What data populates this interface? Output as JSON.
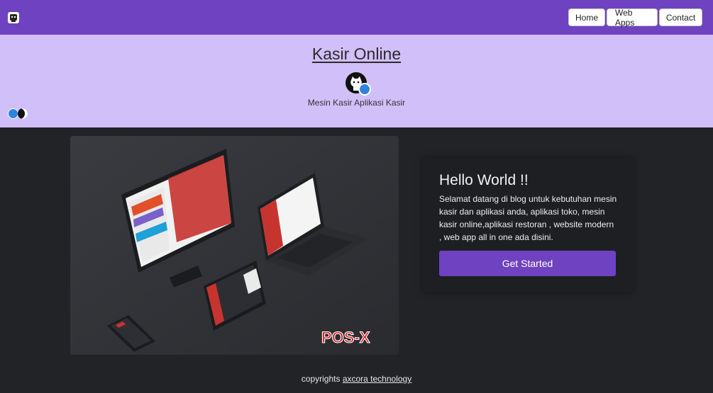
{
  "nav": {
    "items": [
      {
        "label": "Home"
      },
      {
        "label": "Web Apps"
      },
      {
        "label": "Contact"
      }
    ],
    "logo_icon": "github-octocat-icon"
  },
  "hero": {
    "title": "Kasir Online",
    "subtitle": "Mesin Kasir Aplikasi Kasir",
    "avatar_icon": "github-icon",
    "theme_toggle_icon": "theme-toggle-icon"
  },
  "product_image": {
    "brand_text": "POS-X"
  },
  "intro": {
    "title": "Hello World !!",
    "text": "Selamat datang di blog untuk kebutuhan mesin kasir dan aplikasi anda, aplikasi toko, mesin kasir online,aplikasi restoran , website modern , web app all in one ada disini.",
    "cta_label": "Get Started"
  },
  "footer": {
    "prefix": "copyrights",
    "link_text": "axcora technology"
  },
  "colors": {
    "nav_bg": "#6f42c1",
    "hero_bg": "#d1bffa",
    "page_bg": "#212327",
    "accent": "#6f42c1"
  }
}
